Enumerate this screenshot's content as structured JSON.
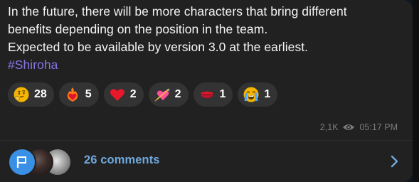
{
  "message": {
    "lines": [
      "In the future, there will be more characters that bring different",
      "benefits depending on the position in the team.",
      "Expected to be available by version 3.0 at the earliest."
    ],
    "hashtag": "#Shiroha"
  },
  "reactions": [
    {
      "icon": "thinking-face-icon",
      "count": "28"
    },
    {
      "icon": "heart-on-fire-icon",
      "count": "5"
    },
    {
      "icon": "red-heart-icon",
      "count": "2"
    },
    {
      "icon": "heart-with-arrow-icon",
      "count": "2"
    },
    {
      "icon": "kiss-mark-icon",
      "count": "1"
    },
    {
      "icon": "loudly-crying-face-icon",
      "count": "1"
    }
  ],
  "meta": {
    "views": "2,1K",
    "time": "05:17 PM",
    "views_icon": "eye-icon"
  },
  "comments": {
    "label": "26 comments",
    "icon": "chevron-right-icon"
  },
  "colors": {
    "bubble": "#212121",
    "hashtag": "#8774e1",
    "comments_link": "#6fa8dc",
    "reaction_pill": "#333333"
  }
}
